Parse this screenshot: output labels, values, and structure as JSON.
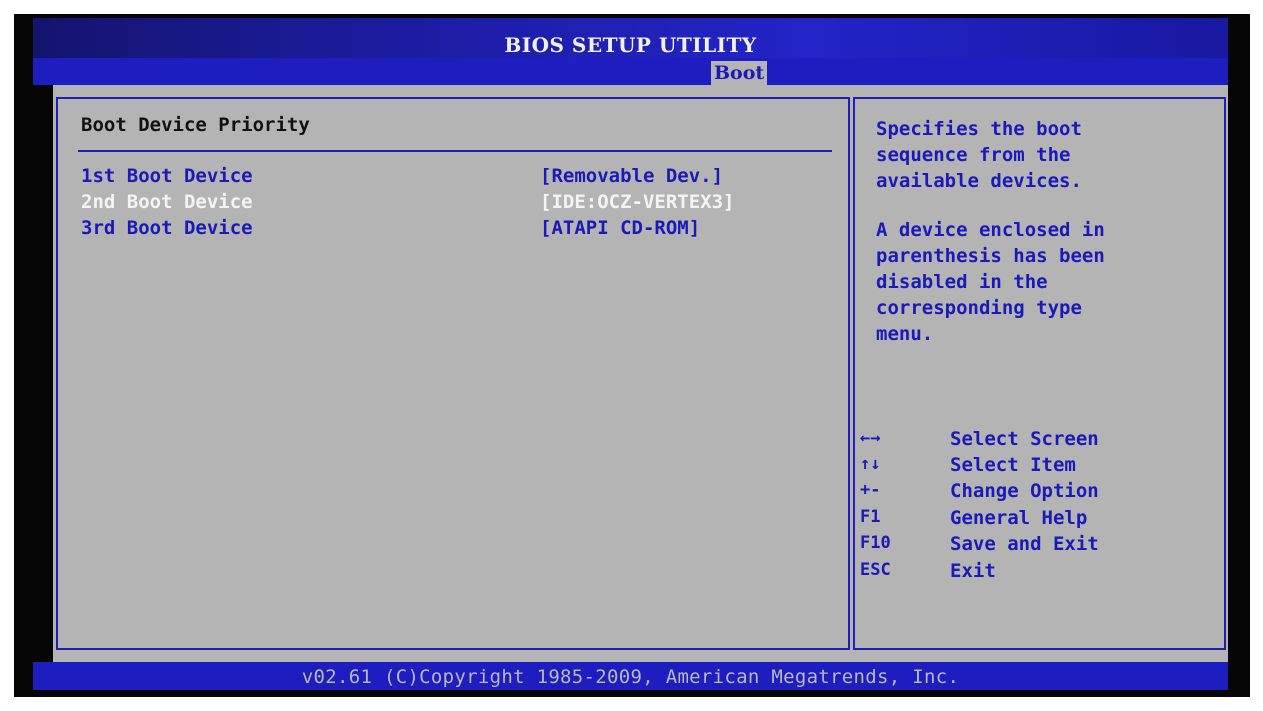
{
  "window": {
    "title": "BIOS SETUP UTILITY",
    "active_tab": "Boot"
  },
  "main": {
    "section_title": "Boot Device Priority",
    "items": [
      {
        "label": "1st Boot Device",
        "value": "[Removable Dev.]",
        "selected": false
      },
      {
        "label": "2nd Boot Device",
        "value": "[IDE:OCZ-VERTEX3]",
        "selected": true
      },
      {
        "label": "3rd Boot Device",
        "value": "[ATAPI CD-ROM]",
        "selected": false
      }
    ]
  },
  "help": {
    "paragraph1": [
      "Specifies the boot",
      "sequence from the",
      "available devices."
    ],
    "paragraph2": [
      "A device enclosed in",
      "parenthesis has been",
      "disabled in the",
      "corresponding type",
      "menu."
    ]
  },
  "keys": [
    {
      "key": "←→",
      "desc": "Select Screen"
    },
    {
      "key": "↑↓",
      "desc": "Select Item"
    },
    {
      "key": "+-",
      "desc": "Change Option"
    },
    {
      "key": "F1",
      "desc": "General Help"
    },
    {
      "key": "F10",
      "desc": "Save and Exit"
    },
    {
      "key": "ESC",
      "desc": "Exit"
    }
  ],
  "footer": {
    "text": "v02.61 (C)Copyright 1985-2009, American Megatrends, Inc."
  },
  "colors": {
    "title_bar": "#1c1ca0",
    "panel_bg": "#b4b4b4",
    "accent_blue": "#1a1ab8",
    "selected_text": "#f4f4f4"
  }
}
